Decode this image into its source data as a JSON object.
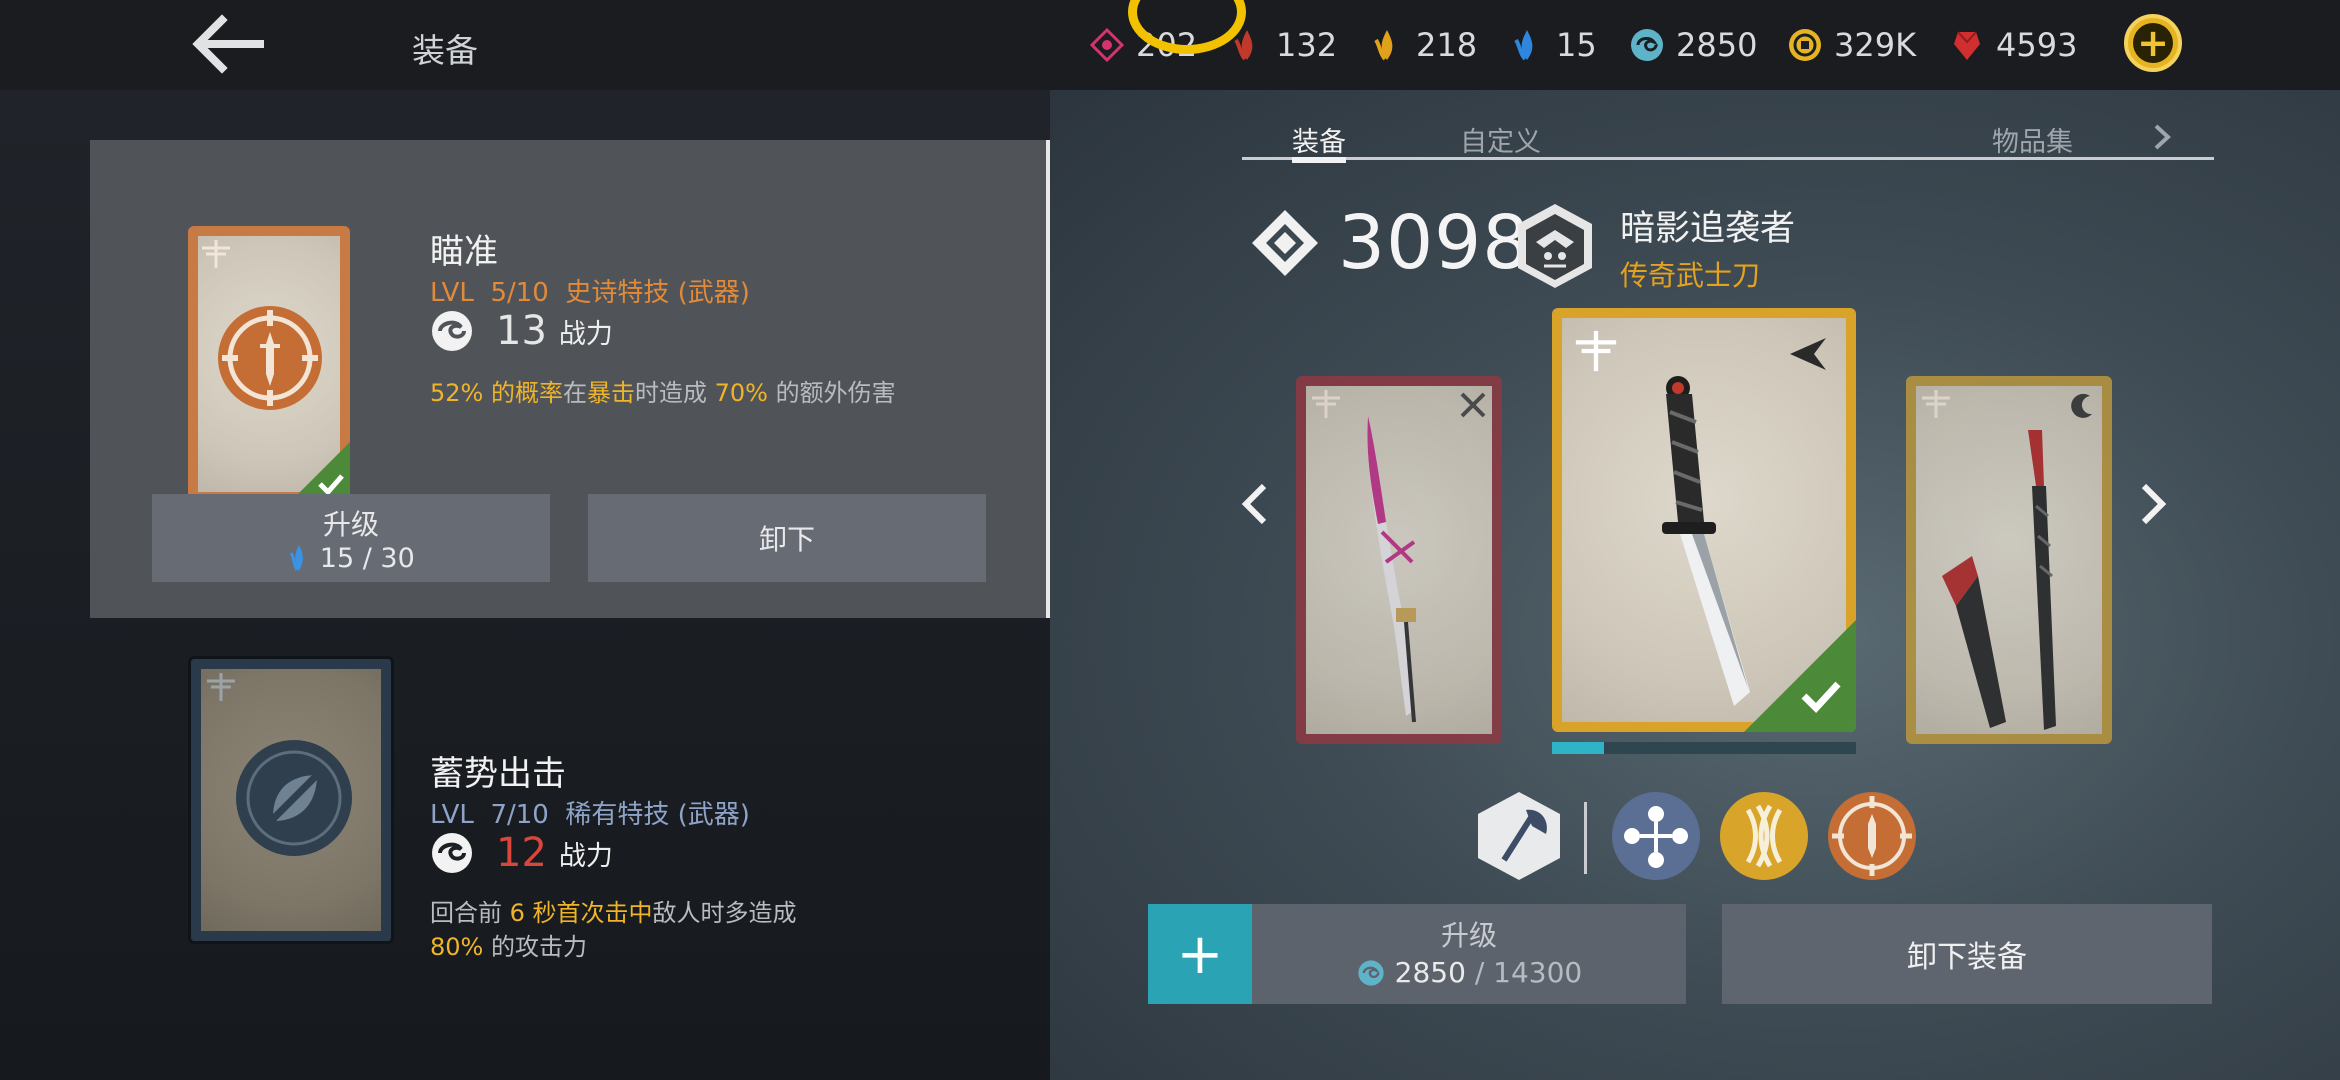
{
  "topbar": {
    "title": "装备",
    "resources": [
      {
        "name": "pink-gem",
        "value": "202",
        "color": "#d6336c"
      },
      {
        "name": "red-crystal",
        "value": "132",
        "color": "#c0392b"
      },
      {
        "name": "gold-crystal",
        "value": "218",
        "color": "#e0a21c"
      },
      {
        "name": "blue-crystal",
        "value": "15",
        "color": "#2e86de"
      },
      {
        "name": "spirit-orb",
        "value": "2850",
        "color": "#5fb3c9"
      },
      {
        "name": "coin",
        "value": "329K",
        "color": "#e6b422"
      },
      {
        "name": "ruby",
        "value": "4593",
        "color": "#d12f2f"
      }
    ]
  },
  "left": {
    "skill1": {
      "name": "瞄准",
      "lvl_prefix": "LVL",
      "lvl": "5/10",
      "rarity": "史诗特技 (武器)",
      "power": "13",
      "power_label": "战力",
      "desc_parts": [
        "52% 的概率",
        "在",
        "暴击",
        "时造成 ",
        "70%",
        " 的额外伤害"
      ],
      "upgrade_label": "升级",
      "upgrade_cost": "15 / 30",
      "unequip_label": "卸下",
      "accent": "#e08a3a"
    },
    "skill2": {
      "name": "蓄势出击",
      "lvl_prefix": "LVL",
      "lvl": "7/10",
      "rarity": "稀有特技 (武器)",
      "power": "12",
      "power_label": "战力",
      "desc_line1_parts": [
        "回合前 ",
        "6 秒首次击中",
        "敌人时多造成"
      ],
      "desc_line2_parts": [
        "80%",
        " 的攻击力"
      ],
      "accent": "#8fa3c8"
    }
  },
  "right": {
    "tabs": [
      "装备",
      "自定义",
      "物品集"
    ],
    "power": "3098",
    "weapon_name": "暗影追袭者",
    "weapon_rarity": "传奇武士刀",
    "xp_fraction": 0.17,
    "upgrade_label": "升级",
    "upgrade_current": "2850",
    "upgrade_total": "/ 14300",
    "unequip_label": "卸下装备"
  }
}
